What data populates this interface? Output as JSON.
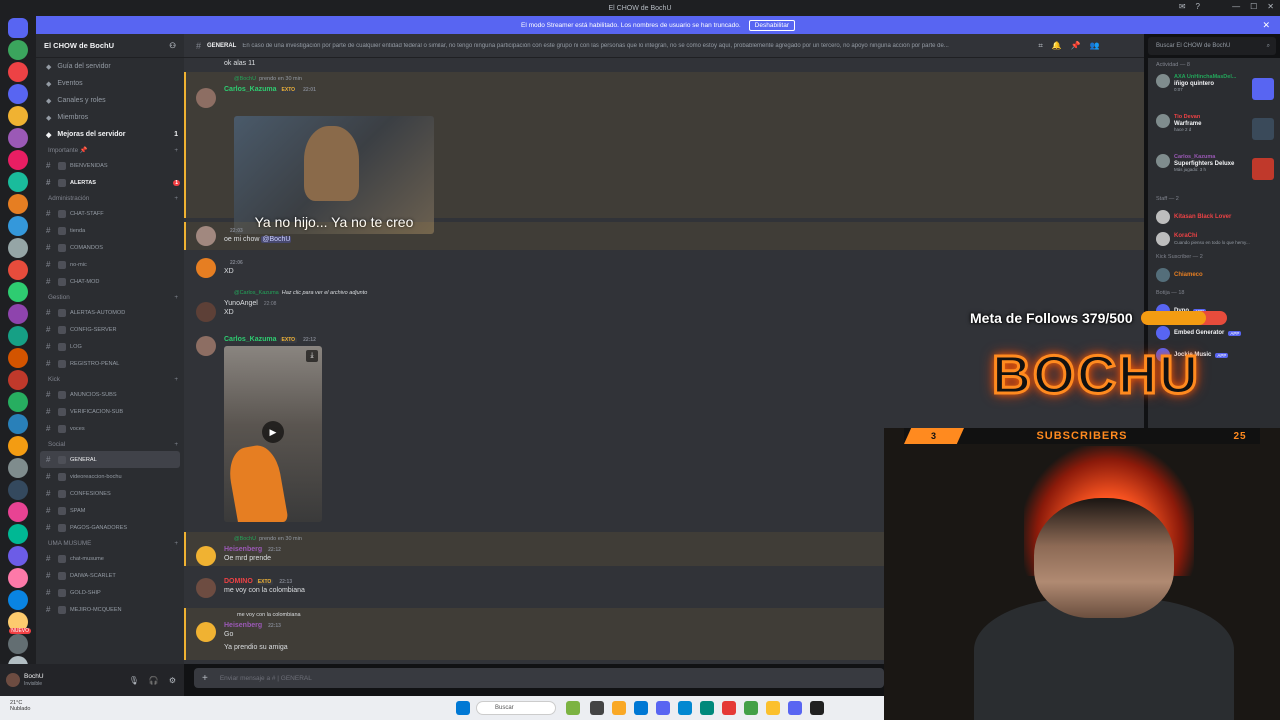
{
  "window": {
    "title": "El CHOW de BochU"
  },
  "banner": {
    "text": "El modo Streamer está habilitado. Los nombres de usuario se han truncado.",
    "button": "Deshabilitar"
  },
  "guilds": {
    "badges": [
      "NUEVO"
    ],
    "colors": [
      "#3ba55d",
      "#ed4245",
      "#5865f2",
      "#f0b232",
      "#9b59b6",
      "#e91e63",
      "#1abc9c",
      "#e67e22",
      "#3498db",
      "#95a5a6",
      "#e74c3c",
      "#2ecc71",
      "#8e44ad",
      "#16a085",
      "#d35400",
      "#c0392b",
      "#27ae60",
      "#2980b9",
      "#f39c12",
      "#7f8c8d",
      "#34495e",
      "#e84393",
      "#00b894",
      "#6c5ce7",
      "#fd79a8",
      "#0984e3",
      "#fdcb6e",
      "#636e72",
      "#b2bec3"
    ]
  },
  "server": {
    "name": "El CHOW de BochU",
    "nav": [
      "Guía del servidor",
      "Eventos",
      "Canales y roles",
      "Miembros",
      "Mejoras del servidor"
    ],
    "boost_count": "1",
    "sections": [
      {
        "category": "Importante 📌",
        "channels": [
          {
            "name": "BIENVENIDAS"
          },
          {
            "name": "ALERTAS",
            "badge": "1"
          }
        ]
      },
      {
        "category": "Administración",
        "channels": [
          {
            "name": "CHAT-STAFF"
          },
          {
            "name": "tienda"
          },
          {
            "name": "COMANDOS"
          },
          {
            "name": "no-mic"
          },
          {
            "name": "CHAT-MOD"
          }
        ]
      },
      {
        "category": "Gestion",
        "channels": [
          {
            "name": "ALERTAS-AUTOMOD"
          },
          {
            "name": "CONFIG-SERVER"
          },
          {
            "name": "LOG"
          },
          {
            "name": "REGISTRO-PENAL"
          }
        ]
      },
      {
        "category": "Kick",
        "channels": [
          {
            "name": "ANUNCIOS-SUBS"
          },
          {
            "name": "VERIFICACION-SUB"
          },
          {
            "name": "voces"
          }
        ]
      },
      {
        "category": "Social",
        "channels": [
          {
            "name": "GENERAL",
            "selected": true
          },
          {
            "name": "videoreaccion-bochu"
          },
          {
            "name": "CONFESIONES"
          },
          {
            "name": "SPAM"
          },
          {
            "name": "PAGOS-GANADORES"
          }
        ]
      },
      {
        "category": "UMA MUSUME",
        "channels": [
          {
            "name": "chat-musume"
          },
          {
            "name": "DAIWA-SCARLET"
          },
          {
            "name": "GOLD-SHIP"
          },
          {
            "name": "MEJIRO-MCQUEEN"
          }
        ]
      }
    ]
  },
  "user": {
    "name": "BochU",
    "status": "Invisible"
  },
  "header": {
    "channel": "GENERAL",
    "topic": "En caso de una investigación por parte de cualquier entidad federal o similar, no tengo ninguna participación con este grupo ni con las personas que lo integran, no sé cómo estoy aquí, probablemente agregado por un tercero, no apoyo ninguna acción por parte de..."
  },
  "search": {
    "placeholder": "Buscar El CHOW de BochU"
  },
  "messages": [
    {
      "top_text": "ok alas 11"
    },
    {
      "reply_user": "@BochU",
      "reply_text": "prendo en 30 min",
      "author": "Carlos_Kazuma",
      "tag": "EXTO",
      "time": "22:01",
      "gif_caption": "Ya no hijo... Ya no te creo"
    },
    {
      "author": "",
      "time": "22:03",
      "text": "oe mi chow",
      "mention": "@BochU"
    },
    {
      "author": "",
      "time": "22:06",
      "text": "XD"
    },
    {
      "reply_user": "@Carlos_Kazuma",
      "reply_text": "Haz clic para ver el archivo adjunto",
      "author": "YunoAngel",
      "time": "22:08",
      "text": "XD"
    },
    {
      "author": "Carlos_Kazuma",
      "tag": "EXTO",
      "time": "22:12"
    },
    {
      "reply_user": "@BochU",
      "reply_text": "prendo en 30 min",
      "author": "Heisenberg",
      "time": "22:12",
      "text": "Oe mrd prende"
    },
    {
      "author": "DOMINO",
      "tag": "EXTO",
      "time": "22:13",
      "text": "me voy con la colombiana"
    },
    {
      "reply_user": "",
      "reply_text": "me voy con la colombiana",
      "author": "Heisenberg",
      "time": "22:13",
      "text": "Go",
      "text2": "Ya prendio su amiga"
    }
  ],
  "composer": {
    "placeholder": "Enviar mensaje a # | GENERAL"
  },
  "members": {
    "activity_title": "Actividad — 8",
    "activities": [
      {
        "name": "AXA UnHinchaMasDel...",
        "game": "iñigo quintero",
        "sub": "0:07"
      },
      {
        "name": "Tio Devan",
        "game": "Warframe",
        "sub": "hace 2 d"
      },
      {
        "name": "Carlos_Kazuma",
        "game": "Superfighters Deluxe",
        "sub": "Más jugado: 3 h"
      }
    ],
    "staff_title": "Staff — 2",
    "staff": [
      {
        "name": "Kitasan Black Lover",
        "color": "#ed4245"
      },
      {
        "name": "KoraChi",
        "color": "#ed4245",
        "status": "Cuando pienso en todo lo que hemy..."
      }
    ],
    "kick_title": "Kick Suscriber — 2",
    "kick": [
      {
        "name": "Chiameco",
        "color": "#e67e22"
      }
    ],
    "bots_title": "Botija — 18",
    "bots": [
      "Dyno",
      "Embed Generator",
      "Jockie Music"
    ],
    "app_badge": "APP"
  },
  "overlay": {
    "goal_label": "Meta de Follows 379/500",
    "goal_progress": 0.758,
    "logo": "BOCHU",
    "subs_label": "SUBSCRIBERS",
    "subs_left": "3",
    "subs_right": "25"
  },
  "taskbar": {
    "weather": "21°C",
    "weather_sub": "Nublado",
    "search": "Buscar"
  }
}
